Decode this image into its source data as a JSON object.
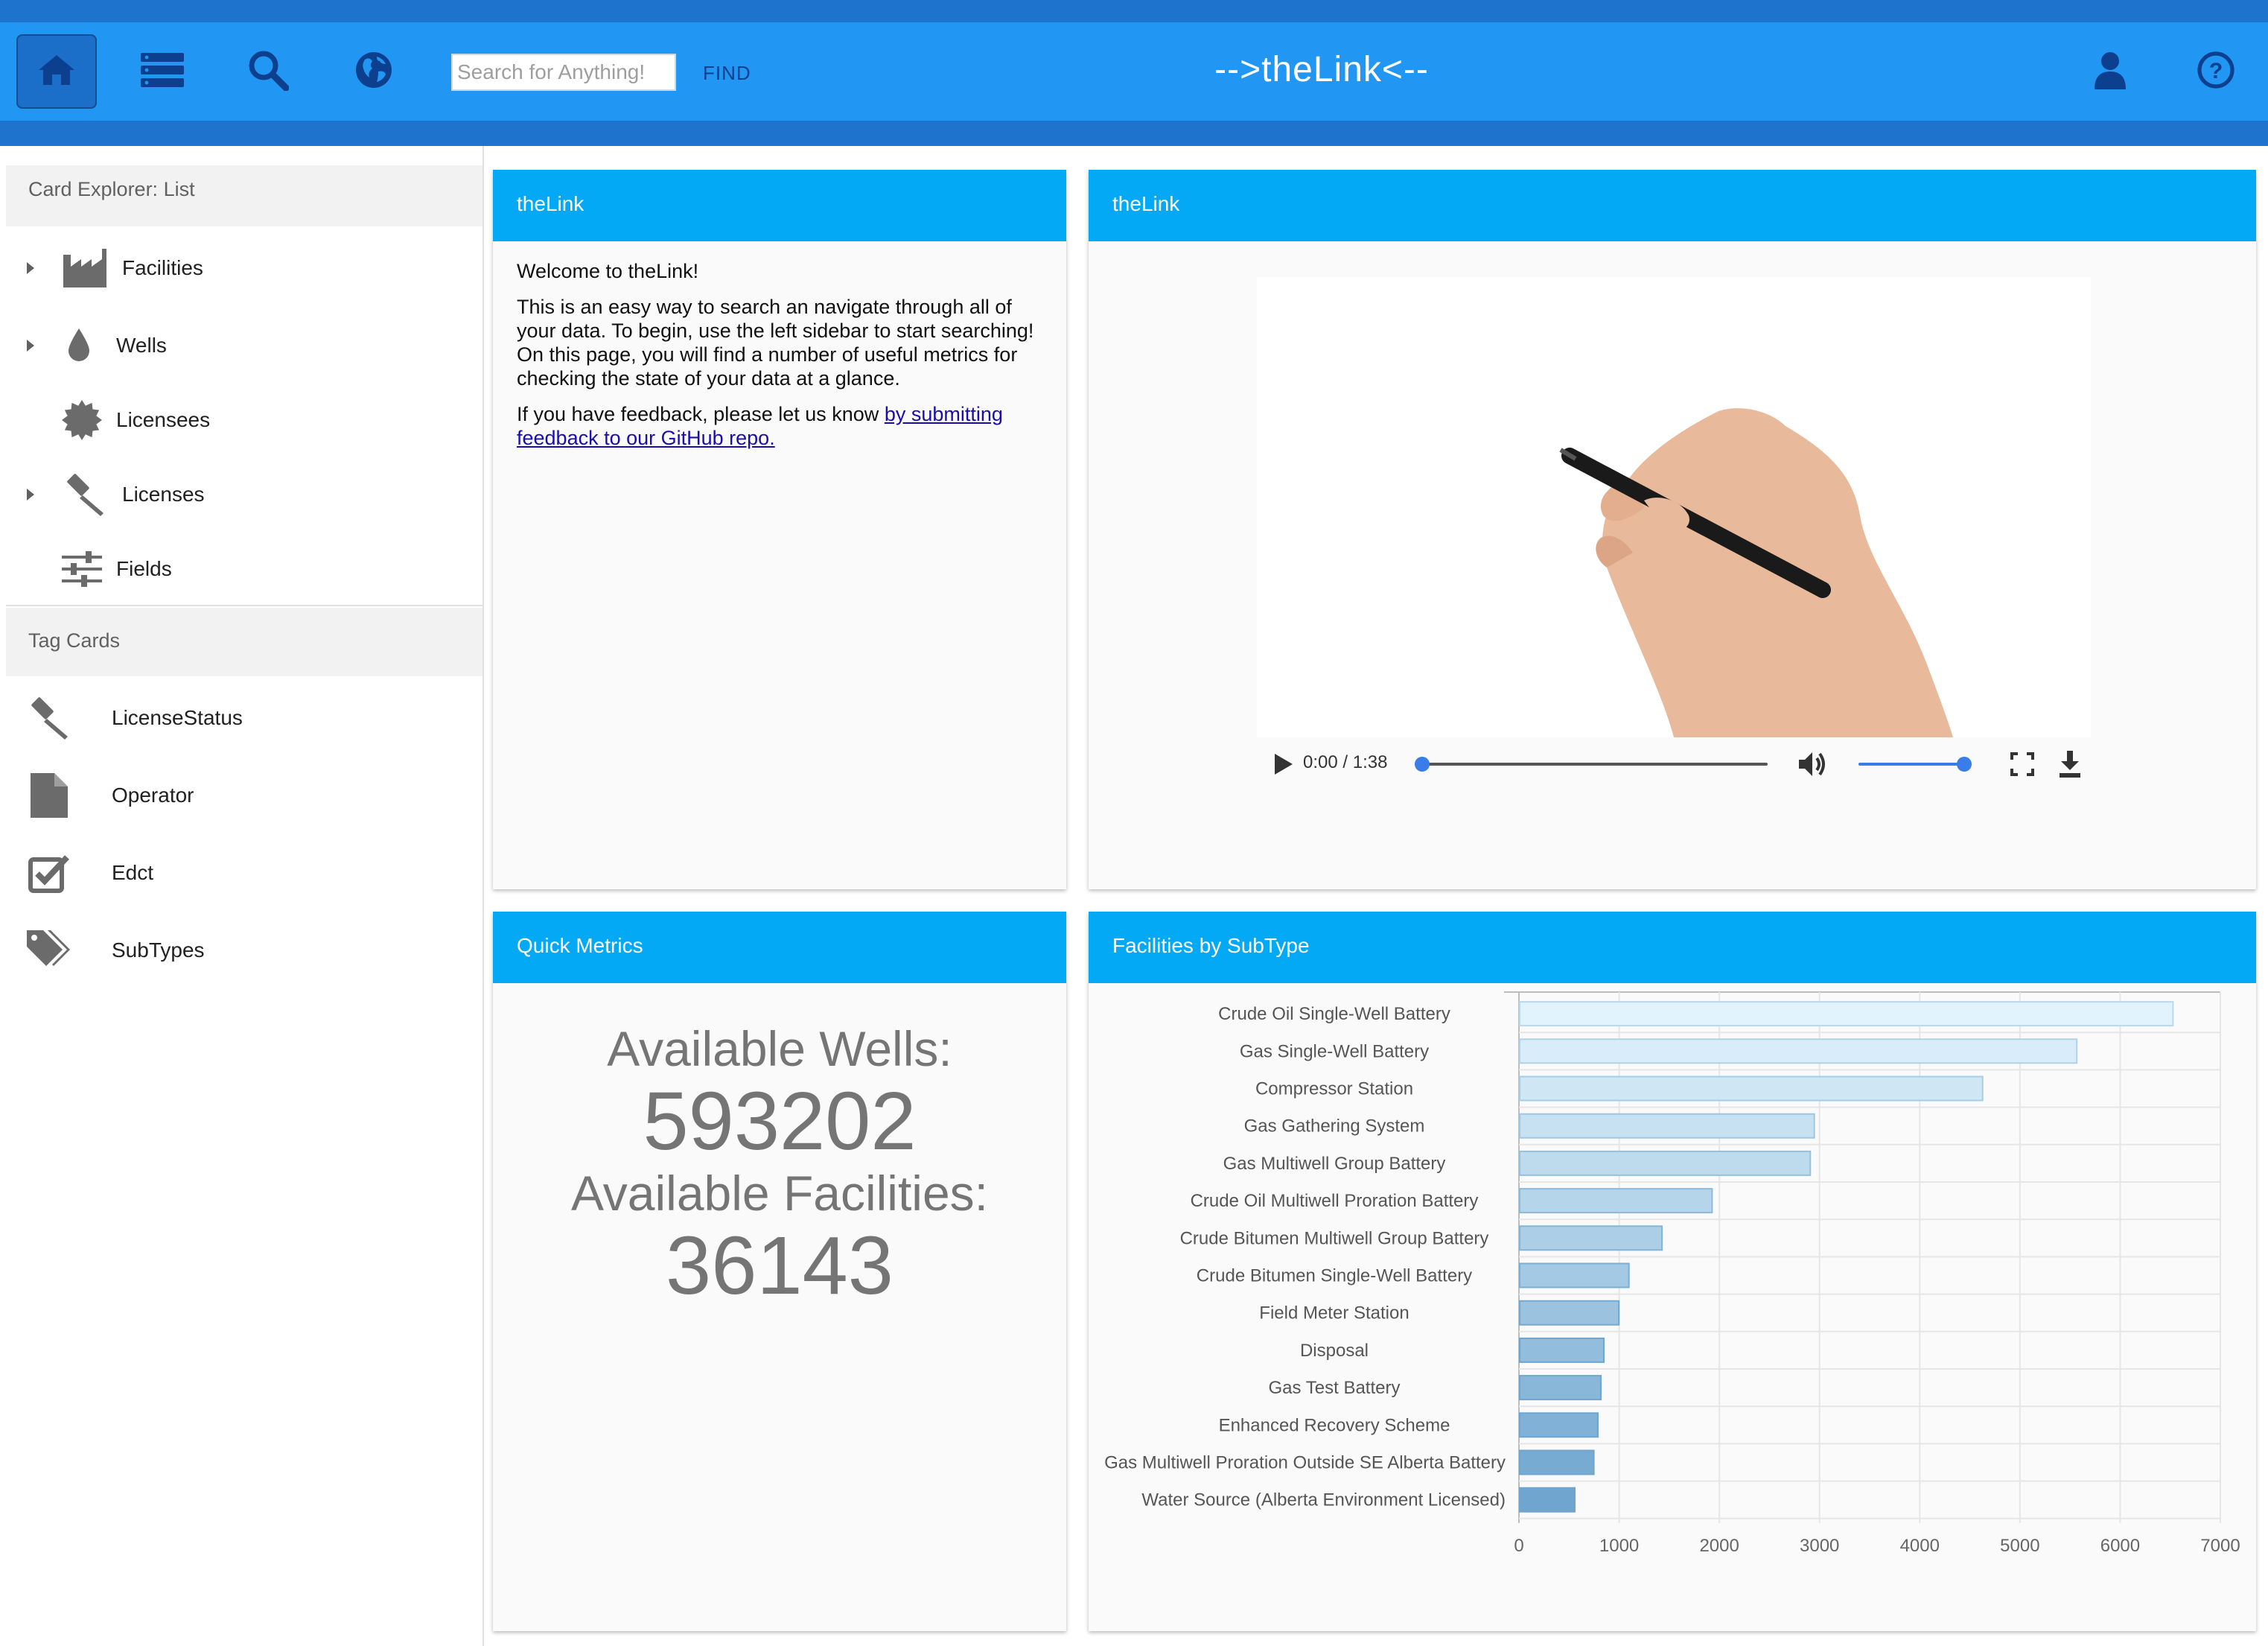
{
  "header": {
    "title": "-->theLink<--",
    "search_placeholder": "Search for Anything!",
    "find_label": "FIND",
    "nav_icons": [
      "home-icon",
      "list-icon",
      "search-icon",
      "globe-icon"
    ],
    "right_icons": [
      "user-icon",
      "help-icon"
    ]
  },
  "sidebar": {
    "card_explorer_heading": "Card Explorer: List",
    "explorer_items": [
      {
        "label": "Facilities",
        "icon": "factory-icon",
        "expandable": true
      },
      {
        "label": "Wells",
        "icon": "drop-icon",
        "expandable": true
      },
      {
        "label": "Licensees",
        "icon": "certificate-icon",
        "expandable": false
      },
      {
        "label": "Licenses",
        "icon": "gavel-icon",
        "expandable": true
      },
      {
        "label": "Fields",
        "icon": "sliders-icon",
        "expandable": false
      }
    ],
    "tag_cards_heading": "Tag Cards",
    "tag_items": [
      {
        "label": "LicenseStatus",
        "icon": "gavel-icon"
      },
      {
        "label": "Operator",
        "icon": "document-icon"
      },
      {
        "label": "Edct",
        "icon": "checkbox-icon"
      },
      {
        "label": "SubTypes",
        "icon": "tags-icon"
      }
    ]
  },
  "welcome_card": {
    "title": "theLink",
    "greeting": "Welcome to theLink!",
    "body": "This is an easy way to search an navigate through all of your data. To begin, use the left sidebar to start searching! On this page, you will find a number of useful metrics for checking the state of your data at a glance.",
    "feedback_prefix": "If you have feedback, please let us know ",
    "feedback_link": "by submitting feedback to our GitHub repo."
  },
  "video_card": {
    "title": "theLink",
    "time": "0:00 / 1:38",
    "progress": 0.0,
    "volume": 1.0
  },
  "metrics_card": {
    "title": "Quick Metrics",
    "wells_label": "Available Wells:",
    "wells_value": "593202",
    "facilities_label": "Available Facilities:",
    "facilities_value": "36143"
  },
  "chart_card": {
    "title": "Facilities by SubType"
  },
  "chart_data": {
    "type": "bar",
    "orientation": "horizontal",
    "categories": [
      "Crude Oil Single-Well Battery",
      "Gas Single-Well Battery",
      "Compressor Station",
      "Gas Gathering System",
      "Gas Multiwell Group Battery",
      "Crude Oil Multiwell Proration Battery",
      "Crude Bitumen Multiwell Group Battery",
      "Crude Bitumen Single-Well Battery",
      "Field Meter Station",
      "Disposal",
      "Gas Test Battery",
      "Enhanced Recovery Scheme",
      "Gas Multiwell Proration Outside SE Alberta Battery",
      "Water Source (Alberta Environment Licensed)"
    ],
    "values": [
      6520,
      5560,
      4620,
      2940,
      2900,
      1920,
      1420,
      1090,
      990,
      840,
      810,
      780,
      740,
      550
    ],
    "xlim": [
      0,
      7000
    ],
    "xticks": [
      0,
      1000,
      2000,
      3000,
      4000,
      5000,
      6000,
      7000
    ],
    "grid": true,
    "colors": {
      "light": "#e1f3fc",
      "dark": "#6fa5cf"
    }
  }
}
